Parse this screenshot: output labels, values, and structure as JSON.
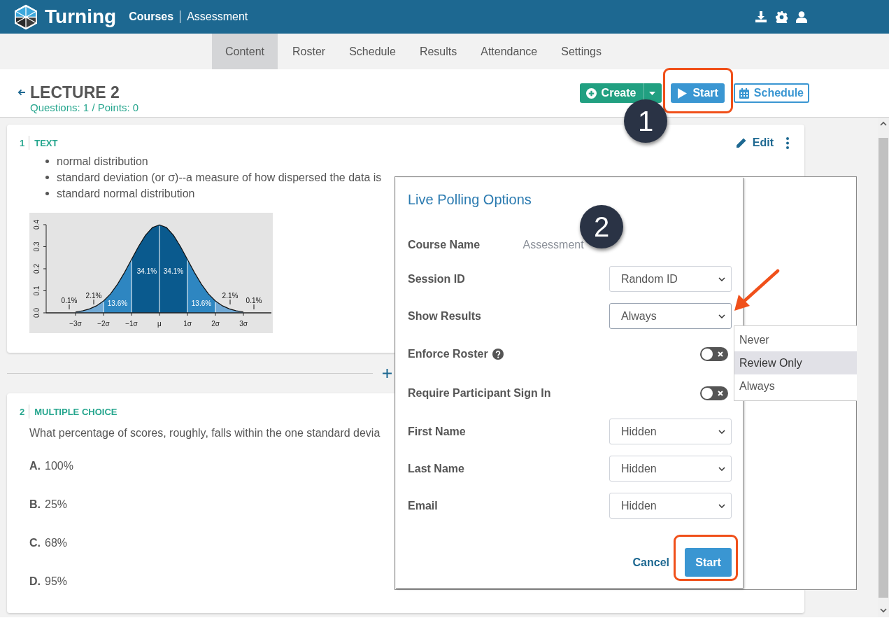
{
  "header": {
    "brand": "Turning",
    "breadcrumb": [
      "Courses",
      "Assessment"
    ]
  },
  "nav_tabs": [
    {
      "label": "Content",
      "selected": true
    },
    {
      "label": "Roster",
      "selected": false
    },
    {
      "label": "Schedule",
      "selected": false
    },
    {
      "label": "Results",
      "selected": false
    },
    {
      "label": "Attendance",
      "selected": false
    },
    {
      "label": "Settings",
      "selected": false
    }
  ],
  "page": {
    "title": "LECTURE 2",
    "summary": "Questions: 1 / Points: 0",
    "buttons": [
      {
        "kind": "create",
        "label": "Create",
        "highlighted": false
      },
      {
        "kind": "start",
        "label": "Start",
        "highlighted": true
      },
      {
        "kind": "schedule",
        "label": "Schedule",
        "highlighted": false
      }
    ]
  },
  "questions": [
    {
      "number": "1",
      "type_label": "TEXT",
      "edit_label": "Edit",
      "bullets": [
        "normal distribution",
        "standard deviation (or σ)--a measure of how dispersed the data is",
        "standard normal distribution"
      ],
      "chart_data": {
        "type": "area",
        "x": [
          -3,
          -2.75,
          -2.5,
          -2.25,
          -2,
          -1.75,
          -1.5,
          -1.25,
          -1,
          -0.75,
          -0.5,
          -0.25,
          0,
          0.25,
          0.5,
          0.75,
          1,
          1.25,
          1.5,
          1.75,
          2,
          2.25,
          2.5,
          2.75,
          3
        ],
        "series": [
          {
            "color": "#6fa8d4",
            "values": [
              0.004,
              0.009,
              0.018,
              0.032,
              0.054,
              null,
              null,
              null,
              null,
              null,
              null,
              null,
              null,
              null,
              null,
              null,
              null,
              null,
              null,
              null,
              0.054,
              0.032,
              0.018,
              0.009,
              0.004
            ]
          },
          {
            "color": "#2e86c1",
            "values": [
              null,
              null,
              null,
              null,
              0.054,
              0.086,
              0.13,
              0.183,
              0.242,
              null,
              null,
              null,
              null,
              null,
              null,
              null,
              0.242,
              0.183,
              0.13,
              0.086,
              0.054,
              null,
              null,
              null,
              null
            ]
          },
          {
            "color": "#0a5a8e",
            "values": [
              null,
              null,
              null,
              null,
              null,
              null,
              null,
              null,
              0.242,
              0.301,
              0.352,
              0.387,
              0.399,
              0.387,
              0.352,
              0.301,
              0.242,
              null,
              null,
              null,
              null,
              null,
              null,
              null,
              null
            ]
          }
        ],
        "xlim": [
          -4,
          4
        ],
        "ylim": [
          0,
          0.4
        ],
        "xticks": [
          {
            "value": -3,
            "label": "−3σ"
          },
          {
            "value": -2,
            "label": "−2σ"
          },
          {
            "value": -1,
            "label": "−1σ"
          },
          {
            "value": 0,
            "label": "μ"
          },
          {
            "value": 1,
            "label": "1σ"
          },
          {
            "value": 2,
            "label": "2σ"
          },
          {
            "value": 3,
            "label": "3σ"
          }
        ],
        "yticks": [
          {
            "value": 0,
            "label": "0.0"
          },
          {
            "value": 0.1,
            "label": "0.1"
          },
          {
            "value": 0.2,
            "label": "0.2"
          },
          {
            "value": 0.3,
            "label": "0.3"
          },
          {
            "value": 0.4,
            "label": "0.4"
          }
        ],
        "annotations": [
          "0.1%",
          "2.1%",
          {
            "text": "13.6%",
            "x": -1.5,
            "y": 0.13
          },
          "34.1%",
          "34.1%",
          {
            "text": "13.6%",
            "x": 1.5,
            "y": 0.13
          },
          "2.1%",
          "0.1%"
        ]
      }
    },
    {
      "number": "2",
      "type_label": "MULTIPLE CHOICE",
      "prompt": "What percentage of scores, roughly, falls within the one standard devia",
      "options": [
        {
          "letter": "A.",
          "text": "100%"
        },
        {
          "letter": "B.",
          "text": "25%"
        },
        {
          "letter": "C.",
          "text": "68%"
        },
        {
          "letter": "D.",
          "text": "95%"
        }
      ]
    }
  ],
  "dialog": {
    "title": "Live Polling Options",
    "fields": [
      {
        "kind": "text",
        "label": "Course Name",
        "value": "Assessment"
      },
      {
        "kind": "select",
        "label": "Session ID",
        "value": "Random ID",
        "open": false
      },
      {
        "kind": "select",
        "label": "Show Results",
        "value": "Always",
        "open": true
      },
      {
        "kind": "toggle",
        "label": "Enforce Roster",
        "on": false,
        "help": true
      },
      {
        "kind": "toggle",
        "label": "Require Participant Sign In",
        "on": false,
        "help": false
      },
      {
        "kind": "select",
        "label": "First Name",
        "value": "Hidden",
        "open": false
      },
      {
        "kind": "select",
        "label": "Last Name",
        "value": "Hidden",
        "open": false
      },
      {
        "kind": "select",
        "label": "Email",
        "value": "Hidden",
        "open": false
      }
    ],
    "dropdown_options": [
      {
        "label": "Never",
        "selected": false
      },
      {
        "label": "Review Only",
        "selected": true
      },
      {
        "label": "Always",
        "selected": false
      }
    ],
    "buttons": [
      {
        "kind": "link",
        "label": "Cancel",
        "highlighted": false
      },
      {
        "kind": "primary",
        "label": "Start",
        "highlighted": true
      }
    ]
  },
  "annotations": [
    {
      "kind": "badge",
      "text": "1"
    },
    {
      "kind": "badge",
      "text": "2"
    },
    {
      "kind": "arrow"
    }
  ]
}
